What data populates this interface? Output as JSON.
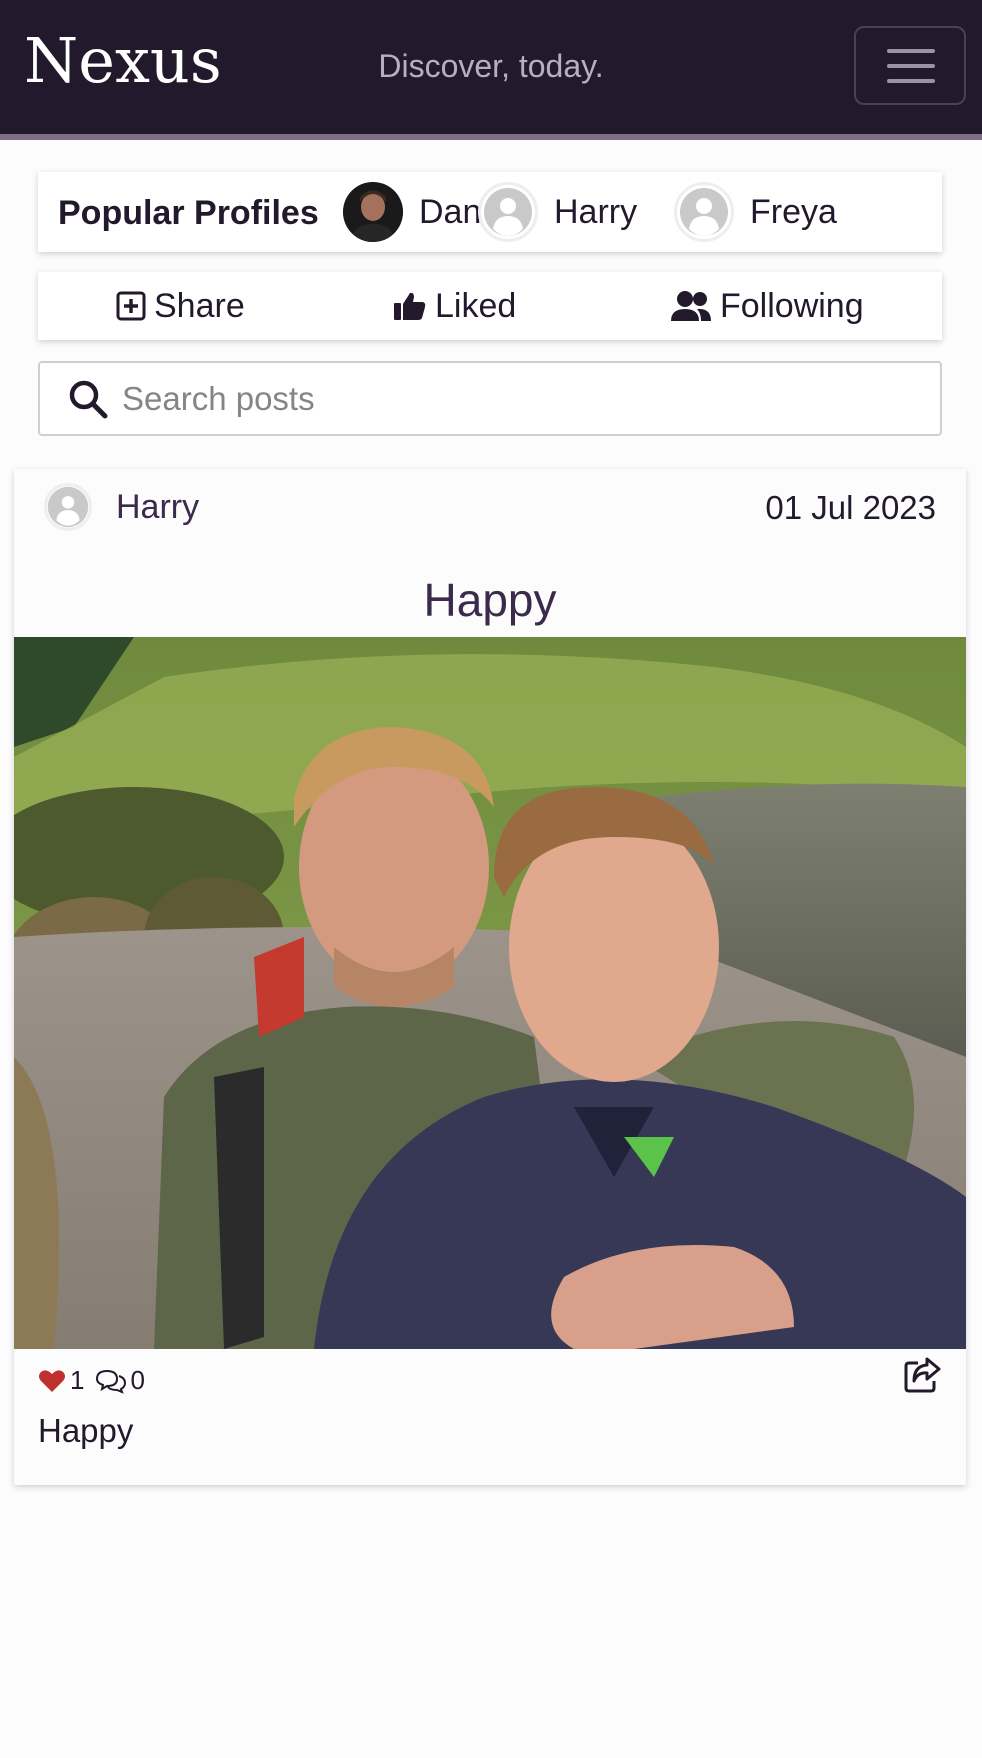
{
  "header": {
    "brand": "Nexus",
    "tagline": "Discover, today.",
    "menu_icon": "hamburger-menu-icon"
  },
  "popular_profiles": {
    "title": "Popular Profiles",
    "profiles": [
      {
        "name": "Dan",
        "avatar": "photo"
      },
      {
        "name": "Harry",
        "avatar": "default-user-icon"
      },
      {
        "name": "Freya",
        "avatar": "default-user-icon"
      }
    ]
  },
  "actions": [
    {
      "label": "Share",
      "icon": "plus-square-icon"
    },
    {
      "label": "Liked",
      "icon": "thumbs-up-icon"
    },
    {
      "label": "Following",
      "icon": "users-icon"
    }
  ],
  "search": {
    "placeholder": "Search posts",
    "value": ""
  },
  "post": {
    "author": "Harry",
    "date": "01 Jul 2023",
    "title": "Happy",
    "likes": "1",
    "comments": "0",
    "caption": "Happy",
    "image": "selfie-photo-two-men-by-lake"
  },
  "colors": {
    "navbar": "#221a2c",
    "navbar_border": "#7e6d89",
    "heart": "#c0302e",
    "text": "#221a2c"
  }
}
